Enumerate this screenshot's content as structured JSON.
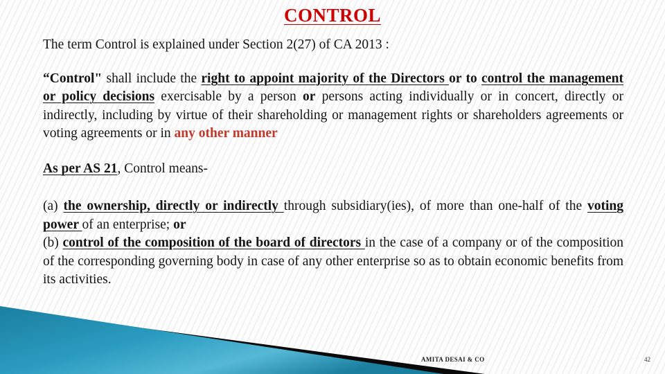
{
  "slide": {
    "title": "CONTROL",
    "title_color": "#cc0000",
    "accent_blue": "#1b87ad",
    "accent_blue_light": "#cfe3ea",
    "background": "#fdfdfd"
  },
  "intro": {
    "text": "The term Control is explained under Section 2(27) of CA 2013 :"
  },
  "definition": {
    "quote_open": "“Control\"",
    "seg_1": " shall include the ",
    "seg_2_bold_underline": "right to appoint majority of the Directors ",
    "seg_3_bold": "or to ",
    "seg_4_bold_underline": "control the  management  or  policy  decisions",
    "seg_5": " exercisable by a person ",
    "seg_6_bold": "or",
    "seg_7": " persons acting individually or in concert, directly or indirectly, including by virtue of their shareholding or management rights or shareholders agreements or voting agreements or in ",
    "seg_8_red_bold": "any other manner"
  },
  "as21": {
    "label_bold_underline": "As per AS 21",
    "rest": ", Control means-"
  },
  "clause_a": {
    "marker": "(a) ",
    "bold_underline": "the  ownership,  directly  or  indirectly ",
    "mid": "through subsidiary(ies), of more than one-half of the ",
    "bold_underline_2": "voting power ",
    "tail": "of an enterprise; ",
    "tail_bold": "or"
  },
  "clause_b": {
    "marker": "(b) ",
    "bold_underline": "control of the composition of the board of directors ",
    "rest": "in the case of a company or of the composition of the corresponding governing body in case of any other enterprise so as to obtain economic benefits from its activities."
  },
  "footer": {
    "credit": "AMITA DESAI & CO",
    "page_number": "42"
  }
}
